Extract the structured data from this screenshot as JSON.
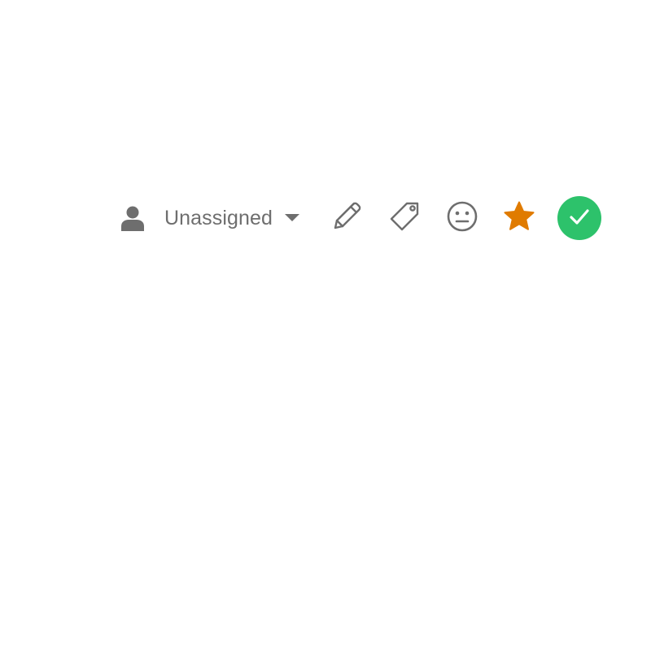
{
  "toolbar": {
    "assignee": {
      "label": "Unassigned",
      "icon": "user-icon",
      "dropdown_icon": "caret-down-icon"
    },
    "actions": [
      {
        "name": "edit",
        "icon": "pencil-icon"
      },
      {
        "name": "tag",
        "icon": "tag-icon"
      },
      {
        "name": "mood",
        "icon": "neutral-face-icon"
      },
      {
        "name": "star",
        "icon": "star-icon",
        "color": "#e07b00"
      },
      {
        "name": "done",
        "icon": "check-icon",
        "color": "#2dc26b"
      }
    ],
    "icon_color": "#6e6e6e"
  }
}
